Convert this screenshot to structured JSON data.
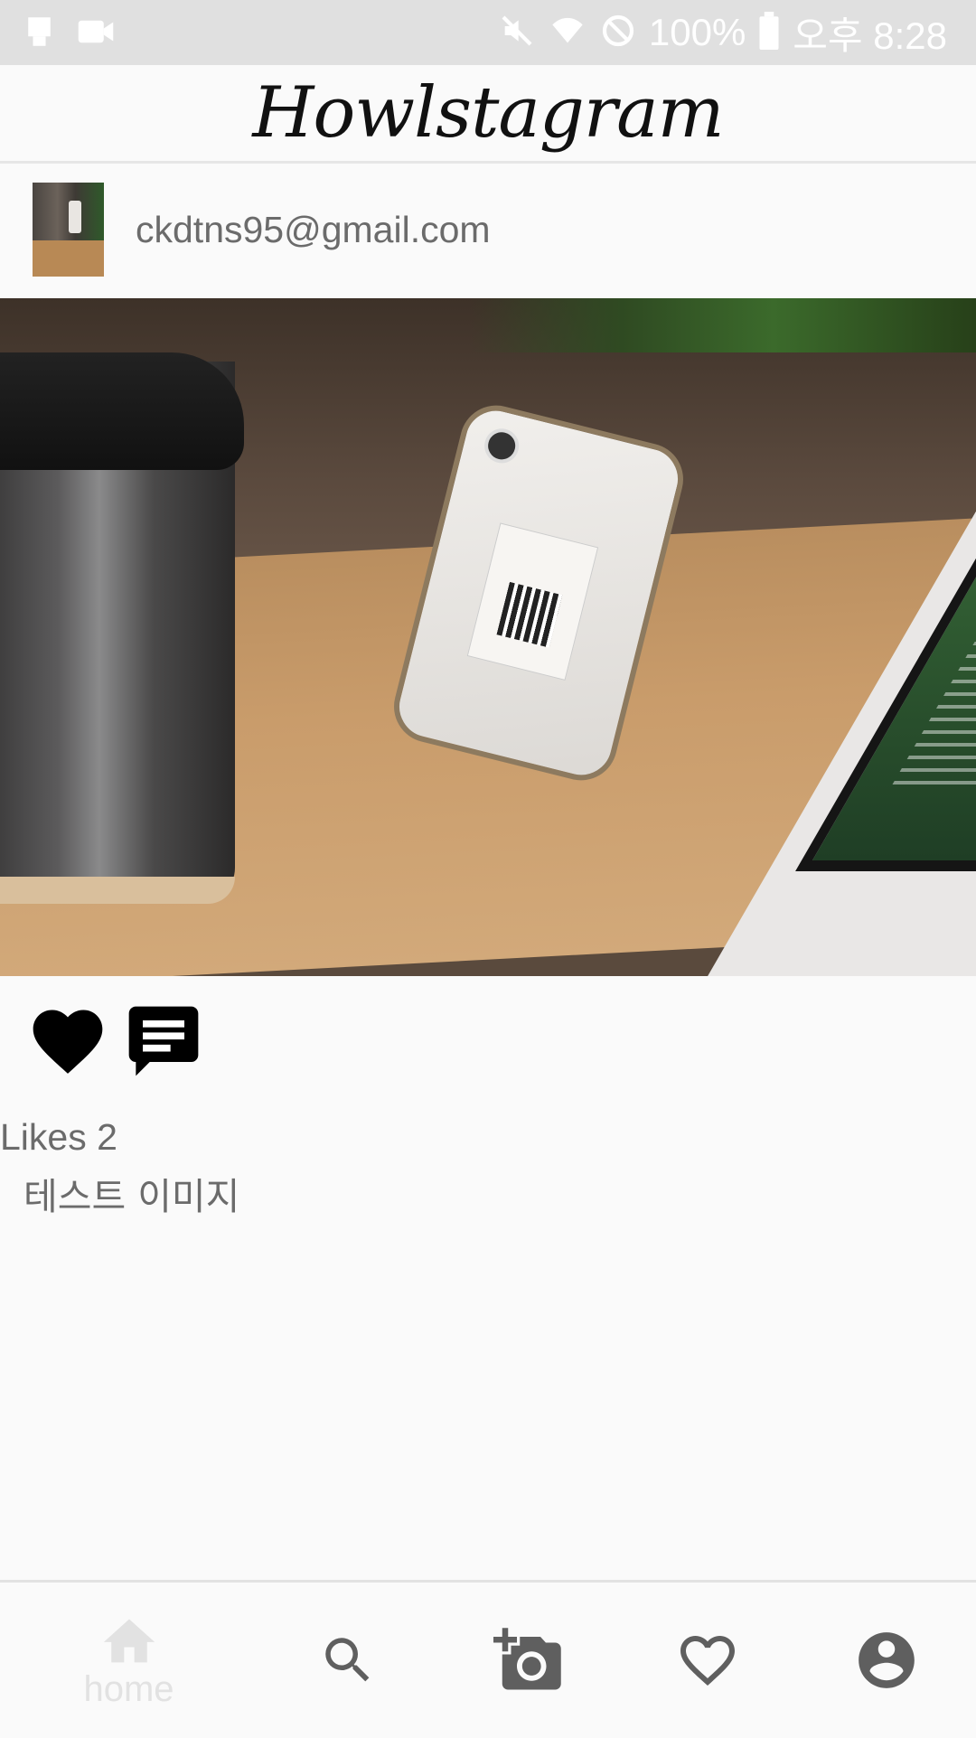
{
  "status_bar": {
    "battery": "100%",
    "time": "오후 8:28",
    "icons": [
      "screenshot-icon",
      "video-icon",
      "mute-icon",
      "wifi-icon",
      "do-not-disturb-icon",
      "battery-icon"
    ]
  },
  "app_bar": {
    "title": "Howlstagram"
  },
  "post": {
    "user_email": "ckdtns95@gmail.com",
    "likes_text": "Likes 2",
    "caption": "테스트 이미지",
    "actions": [
      "heart-icon",
      "comment-icon"
    ]
  },
  "bottom_nav": {
    "items": [
      {
        "icon": "home-icon",
        "label": "home",
        "selected": true
      },
      {
        "icon": "search-icon",
        "label": ""
      },
      {
        "icon": "add-photo-icon",
        "label": ""
      },
      {
        "icon": "favorite-outline-icon",
        "label": ""
      },
      {
        "icon": "account-icon",
        "label": ""
      }
    ]
  },
  "colors": {
    "status_bar_bg": "#e0e0e0",
    "text_secondary": "#6b6b6b",
    "nav_icon": "#5f5f5f",
    "nav_selected_faded": "#e2e2e2"
  }
}
